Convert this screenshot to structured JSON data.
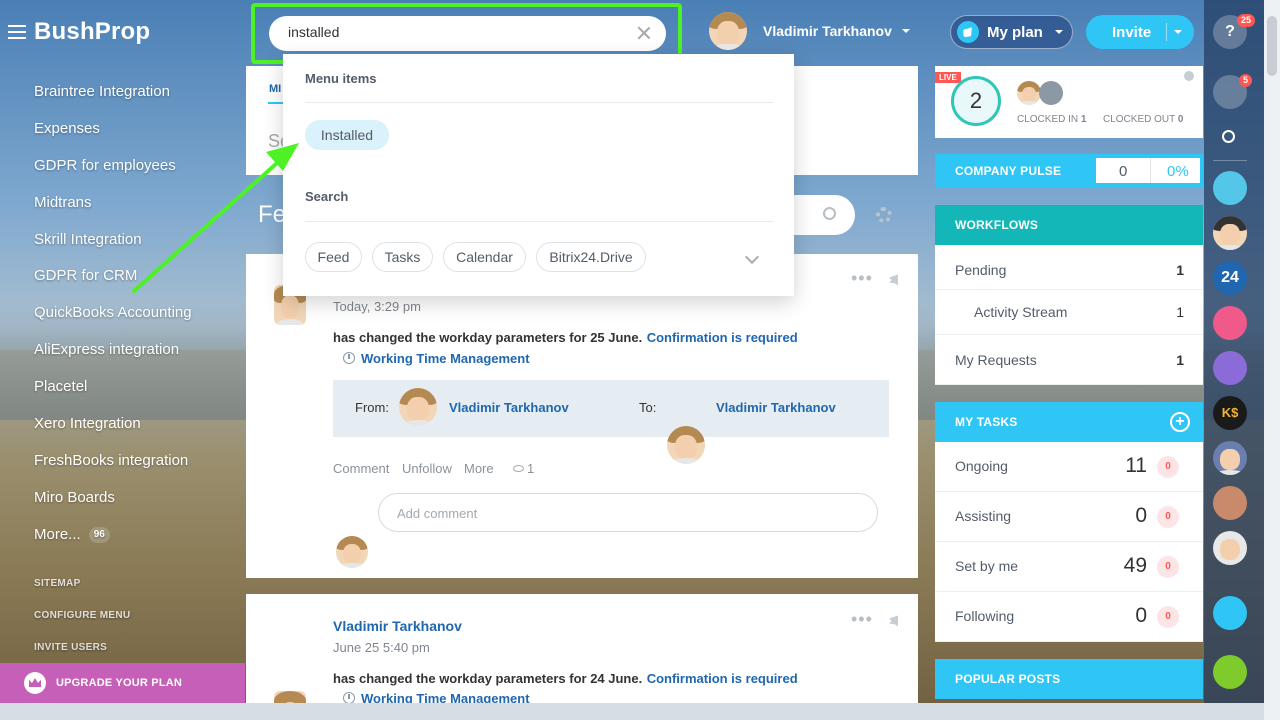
{
  "app": {
    "logo": "BushProp"
  },
  "sidebar": {
    "items": [
      {
        "label": "Braintree Integration"
      },
      {
        "label": "Expenses"
      },
      {
        "label": "GDPR for employees"
      },
      {
        "label": "Midtrans"
      },
      {
        "label": "Skrill Integration"
      },
      {
        "label": "GDPR for CRM"
      },
      {
        "label": "QuickBooks Accounting"
      },
      {
        "label": "AliExpress integration"
      },
      {
        "label": "Placetel"
      },
      {
        "label": "Xero Integration"
      },
      {
        "label": "FreshBooks integration"
      },
      {
        "label": "Miro Boards"
      }
    ],
    "more_label": "More...",
    "more_count": "96",
    "sitemap": "SITEMAP",
    "configure_menu": "CONFIGURE MENU",
    "invite_users": "INVITE USERS",
    "upgrade": "UPGRADE YOUR PLAN"
  },
  "search": {
    "value": "installed"
  },
  "dropdown": {
    "menu_items_title": "Menu items",
    "menu_item_installed": "Installed",
    "search_title": "Search",
    "chips": [
      "Feed",
      "Tasks",
      "Calendar",
      "Bitrix24.Drive"
    ]
  },
  "header": {
    "user_name": "Vladimir Tarkhanov",
    "myplan": "My plan",
    "invite": "Invite",
    "help_badge": "25"
  },
  "feed": {
    "tab_partial": "MI",
    "input_partial": "Se",
    "title_partial": "Fe",
    "post1": {
      "time": "Today, 3:29 pm",
      "text": "has changed the workday parameters for 25 June.",
      "link": "Confirmation is required",
      "module": "Working Time Management",
      "from_label": "From:",
      "from_user": "Vladimir Tarkhanov",
      "to_label": "To:",
      "to_user": "Vladimir Tarkhanov",
      "comment": "Comment",
      "unfollow": "Unfollow",
      "more": "More",
      "views": "1",
      "add_comment": "Add comment"
    },
    "post2": {
      "author": "Vladimir Tarkhanov",
      "time": "June 25 5:40 pm",
      "text": "has changed the workday parameters for 24 June.",
      "link": "Confirmation is required",
      "module": "Working Time Management"
    }
  },
  "timeman": {
    "live": "LIVE",
    "count": "2",
    "clocked_in": "CLOCKED IN",
    "clocked_in_count": "1",
    "clocked_out": "CLOCKED OUT",
    "clocked_out_count": "0"
  },
  "pulse": {
    "title": "COMPANY PULSE",
    "value": "0",
    "percent": "0%"
  },
  "workflows": {
    "title": "WORKFLOWS",
    "rows": [
      {
        "label": "Pending",
        "count": "1"
      },
      {
        "label": "Activity Stream",
        "count": "1"
      },
      {
        "label": "My Requests",
        "count": "1"
      }
    ]
  },
  "tasks": {
    "title": "MY TASKS",
    "rows": [
      {
        "label": "Ongoing",
        "count": "11",
        "badge": "0"
      },
      {
        "label": "Assisting",
        "count": "0",
        "badge": "0"
      },
      {
        "label": "Set by me",
        "count": "49",
        "badge": "0"
      },
      {
        "label": "Following",
        "count": "0",
        "badge": "0"
      }
    ]
  },
  "popular": {
    "title": "POPULAR POSTS"
  },
  "right_bar": {
    "notif_badge": "5",
    "b24": "24",
    "ks": "K$"
  },
  "colors": {
    "accent": "#2fc6f6",
    "highlight": "#4df226",
    "upgrade": "#c65fb8",
    "teal": "#13b7b7"
  }
}
